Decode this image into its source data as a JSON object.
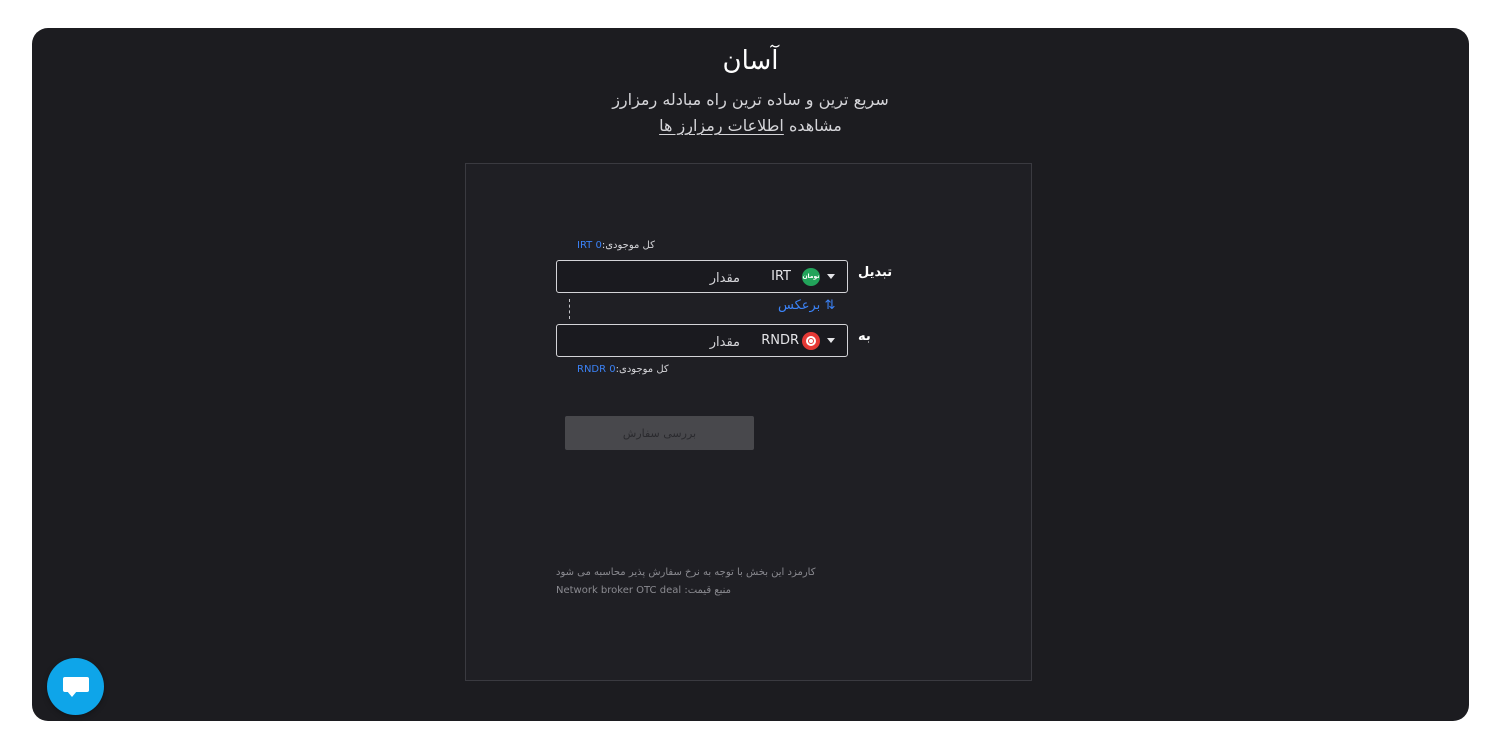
{
  "header": {
    "title": "آسان",
    "subtitle": "سریع ترین و ساده ترین راه مبادله رمزارز",
    "info_prefix": "مشاهده",
    "info_link": "اطلاعات رمزارز ها"
  },
  "form": {
    "from": {
      "balance_label": "کل موجودی:",
      "balance_value": "0 IRT",
      "label": "تبدیل",
      "currency": "IRT",
      "currency_icon_text": "تومان",
      "placeholder": "مقدار"
    },
    "swap_label": "برعکس",
    "swap_icon": "⇅",
    "to": {
      "balance_label": "کل موجودی:",
      "balance_value": "0 RNDR",
      "label": "به",
      "currency": "RNDR",
      "placeholder": "مقدار"
    },
    "review_button": "بررسی سفارش",
    "fee_note": "کارمزد این بخش با توجه به نرخ سفارش پذیر محاسبه می شود",
    "price_source_label": "منبع قیمت:",
    "price_source_value": "Network broker OTC deal"
  },
  "icons": {
    "from_currency": "toman-icon",
    "to_currency": "rndr-icon",
    "swap": "swap-arrows-icon",
    "chat": "chat-bubble-icon"
  },
  "colors": {
    "frame_bg": "#1c1c20",
    "accent": "#3b82f6",
    "chat_button": "#0ea5e9",
    "toman_green": "#22a35a",
    "rndr_red": "#e53935"
  }
}
